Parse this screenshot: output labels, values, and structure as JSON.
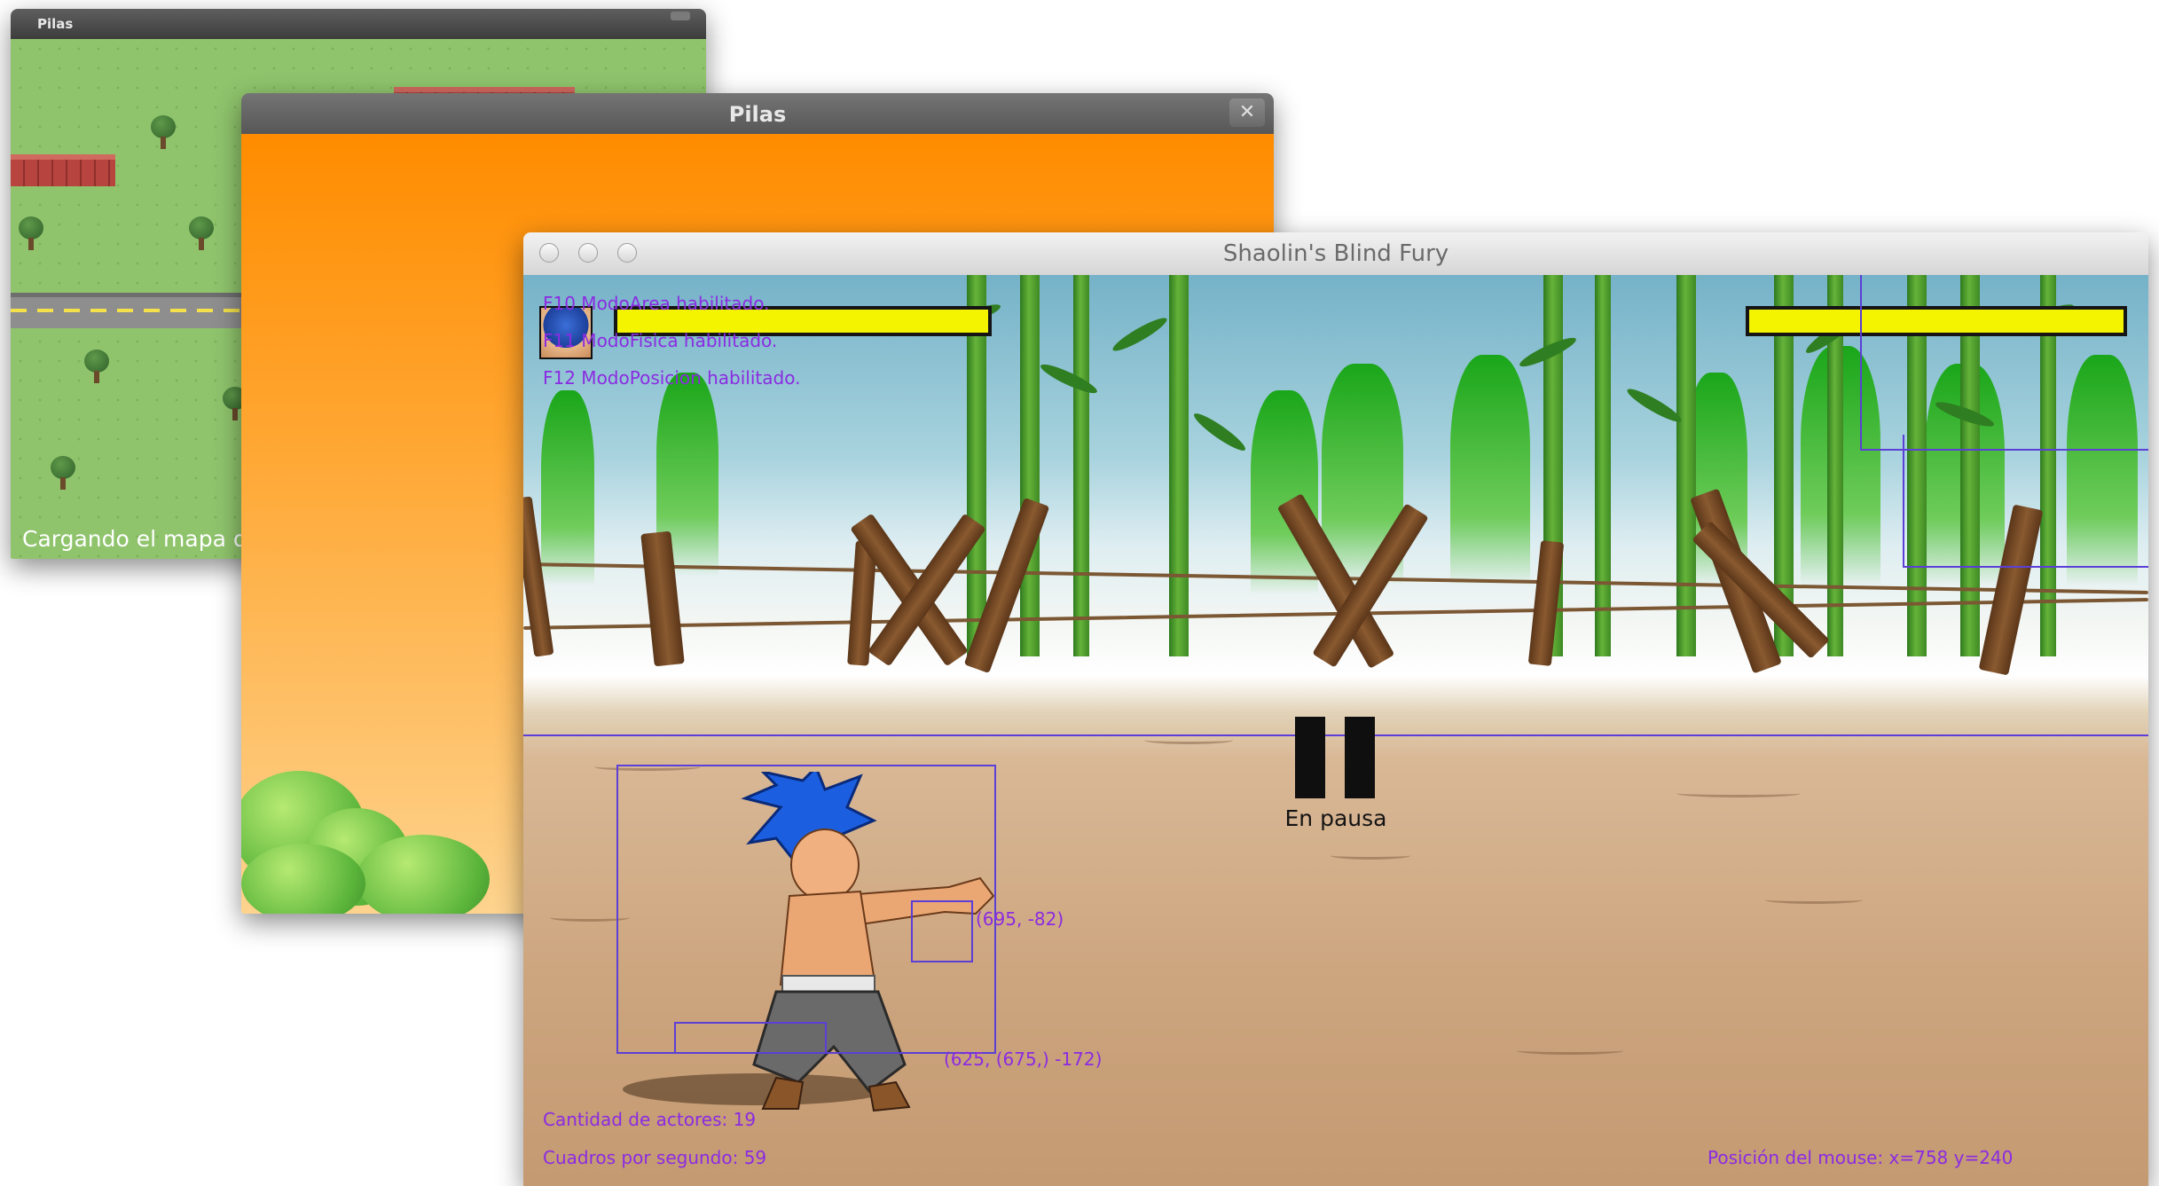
{
  "window_map": {
    "title": "Pilas",
    "status": "Cargando el mapa d"
  },
  "window_orange": {
    "title": "Pilas",
    "close_glyph": "✕"
  },
  "window_game": {
    "title": "Shaolin's Blind Fury",
    "debug_modes": [
      "F10 ModoArea habilitado.",
      "F11 ModoFisica habilitado.",
      "F12 ModoPosicion habilitado."
    ],
    "player_health": 1.0,
    "enemy_health": 1.0,
    "pause_label": "En pausa",
    "coords": {
      "hand": "(695, -82)",
      "feet": "(625, (675,) -172)"
    },
    "stats": {
      "actors": "Cantidad de actores: 19",
      "fps": "Cuadros por segundo: 59",
      "mouse": "Posición del mouse: x=758 y=240"
    }
  },
  "colors": {
    "debug_text": "#8b2be2",
    "debug_box": "#5b3fd6",
    "health": "#f4f400",
    "orange_bg": "#ff8c00"
  },
  "icons": [
    "close-icon",
    "pause-icon",
    "traffic-light-close",
    "traffic-light-minimize",
    "traffic-light-zoom"
  ]
}
